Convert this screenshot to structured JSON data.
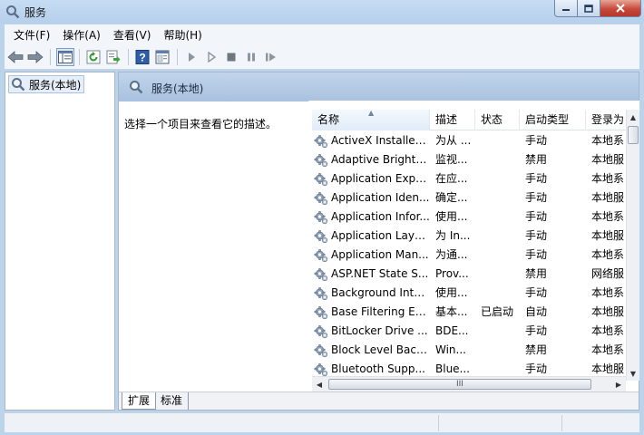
{
  "window": {
    "title": "服务"
  },
  "menu": [
    "文件(F)",
    "操作(A)",
    "查看(V)",
    "帮助(H)"
  ],
  "toolbar": [
    "back-icon",
    "forward-icon",
    "console-tree-icon",
    "refresh-icon",
    "export-icon",
    "help-icon",
    "properties-icon",
    "start-icon",
    "start-alt-icon",
    "stop-icon",
    "pause-icon",
    "restart-icon"
  ],
  "tree": {
    "item": "服务(本地)"
  },
  "panel": {
    "title": "服务(本地)",
    "description": "选择一个项目来查看它的描述。"
  },
  "table": {
    "columns": [
      "名称",
      "描述",
      "状态",
      "启动类型",
      "登录为"
    ],
    "rows": [
      {
        "name": "ActiveX Installer ...",
        "desc": "为从 ...",
        "status": "",
        "startup": "手动",
        "logon": "本地系"
      },
      {
        "name": "Adaptive Brightn...",
        "desc": "监视...",
        "status": "",
        "startup": "禁用",
        "logon": "本地服"
      },
      {
        "name": "Application Expe...",
        "desc": "在应...",
        "status": "",
        "startup": "手动",
        "logon": "本地系"
      },
      {
        "name": "Application Iden...",
        "desc": "确定...",
        "status": "",
        "startup": "手动",
        "logon": "本地服"
      },
      {
        "name": "Application Infor...",
        "desc": "使用...",
        "status": "",
        "startup": "手动",
        "logon": "本地系"
      },
      {
        "name": "Application Laye...",
        "desc": "为 In...",
        "status": "",
        "startup": "手动",
        "logon": "本地服"
      },
      {
        "name": "Application Man...",
        "desc": "为通...",
        "status": "",
        "startup": "手动",
        "logon": "本地系"
      },
      {
        "name": "ASP.NET State S...",
        "desc": "Prov...",
        "status": "",
        "startup": "禁用",
        "logon": "网络服"
      },
      {
        "name": "Background Inte...",
        "desc": "使用...",
        "status": "",
        "startup": "手动",
        "logon": "本地系"
      },
      {
        "name": "Base Filtering En...",
        "desc": "基本...",
        "status": "已启动",
        "startup": "自动",
        "logon": "本地服"
      },
      {
        "name": "BitLocker Drive ...",
        "desc": "BDE...",
        "status": "",
        "startup": "手动",
        "logon": "本地系"
      },
      {
        "name": "Block Level Back...",
        "desc": "Win...",
        "status": "",
        "startup": "禁用",
        "logon": "本地系"
      },
      {
        "name": "Bluetooth Supp...",
        "desc": "Blue...",
        "status": "",
        "startup": "手动",
        "logon": "本地服"
      }
    ]
  },
  "tabs": [
    "扩展",
    "标准"
  ],
  "scrollbar": {
    "grip": "III"
  }
}
